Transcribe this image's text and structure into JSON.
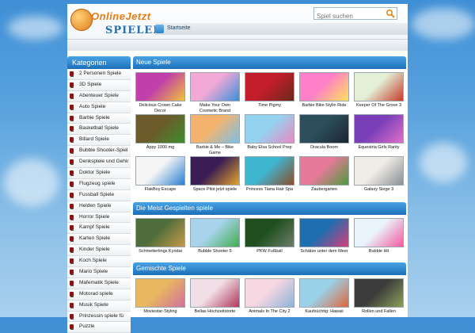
{
  "logo": {
    "line1": "OnlineJetzt",
    "line2": "SPIELEN"
  },
  "search": {
    "placeholder": "Spiel suchen"
  },
  "nav": {
    "tab": "Startseite"
  },
  "sidebar": {
    "title": "Kategorien",
    "items": [
      "2 Personen Spiele",
      "3D Spiele",
      "Abenteuer Spiele",
      "Auto Spiele",
      "Barbie Spiele",
      "Basketball Spiele",
      "Billard Spiele",
      "Bubble Shooter-Spiel",
      "Denkspiele und Gehir",
      "Doktor Spiele",
      "Flugzeug spiele",
      "Fussball Spiele",
      "Helden Spiele",
      "Horror Spiele",
      "Kampf Spiele",
      "Karten Spiele",
      "Kinder Spiele",
      "Koch Spiele",
      "Mario Spiele",
      "Mafematik Spiele",
      "Motorad spiele",
      "Musik Spiele",
      "Prinzessin spiele fü",
      "Puzzle"
    ]
  },
  "sections": [
    {
      "title": "Neue Spiele",
      "games": [
        {
          "label": "Delicious Crown Cake Decor",
          "colors": [
            "#c03fa8",
            "#f0c23a"
          ]
        },
        {
          "label": "Make Your Own Cosmetic Brand",
          "colors": [
            "#f2a9d6",
            "#3b8fd8"
          ]
        },
        {
          "label": "Time Pigmy",
          "colors": [
            "#c41d2b",
            "#6b2a1c"
          ]
        },
        {
          "label": "Barbie Bike Stylin Ride",
          "colors": [
            "#ff7fc8",
            "#ffe25a"
          ]
        },
        {
          "label": "Keeper Of The Grove 3",
          "colors": [
            "#e3f0d7",
            "#c43b2a"
          ]
        },
        {
          "label": "Appy 1000 mg",
          "colors": [
            "#6c5b2b",
            "#3e8d2c"
          ]
        },
        {
          "label": "Barbie & Me – Bike Game",
          "colors": [
            "#f3b36f",
            "#7bc0e8"
          ]
        },
        {
          "label": "Baby Elsa School Prep",
          "colors": [
            "#93d3f0",
            "#e88ac2"
          ]
        },
        {
          "label": "Dracula Boom",
          "colors": [
            "#2c4d5a",
            "#1b2430"
          ]
        },
        {
          "label": "Equestria Girls Rarity",
          "colors": [
            "#7a3fb8",
            "#e070c9"
          ]
        },
        {
          "label": "FlakBoy Escape",
          "colors": [
            "#f5f5f5",
            "#2a7fd1"
          ]
        },
        {
          "label": "Space Pilot jetzt spiele",
          "colors": [
            "#3a1d55",
            "#e6a52b"
          ]
        },
        {
          "label": "Princess Tiana Hair Spa",
          "colors": [
            "#3fb6d0",
            "#8a4d2b"
          ]
        },
        {
          "label": "Zaubergarten",
          "colors": [
            "#e57a9a",
            "#4f9a3b"
          ]
        },
        {
          "label": "Galaxy Siege 3",
          "colors": [
            "#f0ede6",
            "#8a8f96"
          ]
        }
      ]
    },
    {
      "title": "Die Meist Gespielten spiele",
      "games": [
        {
          "label": "Schmetterlings Kyodai",
          "colors": [
            "#4f6d3a",
            "#c59a4a"
          ]
        },
        {
          "label": "Bubble Shooter 5",
          "colors": [
            "#a8d3ea",
            "#3fae4f"
          ]
        },
        {
          "label": "PKW Fußball",
          "colors": [
            "#1f4f1f",
            "#6d7d6a"
          ]
        },
        {
          "label": "Schätze unter dem Meer",
          "colors": [
            "#1d6fb0",
            "#d93c7a"
          ]
        },
        {
          "label": "Bubble Hit",
          "colors": [
            "#e9f3fb",
            "#f25a9e"
          ]
        }
      ]
    },
    {
      "title": "Gemischte Spiele",
      "games": [
        {
          "label": "Moviestar-Styling",
          "colors": [
            "#e8b860",
            "#d06f9a"
          ]
        },
        {
          "label": "Bellas Hochzeitstorte",
          "colors": [
            "#f0dfe6",
            "#b2355a"
          ]
        },
        {
          "label": "Animals In The City 2",
          "colors": [
            "#f7d7e2",
            "#8fb3d9"
          ]
        },
        {
          "label": "Kaufsüchtig: Hawaii",
          "colors": [
            "#9ad1e8",
            "#e0663a"
          ]
        },
        {
          "label": "Rollen und Fallen",
          "colors": [
            "#3b3b3b",
            "#8ba05a"
          ]
        }
      ]
    }
  ]
}
